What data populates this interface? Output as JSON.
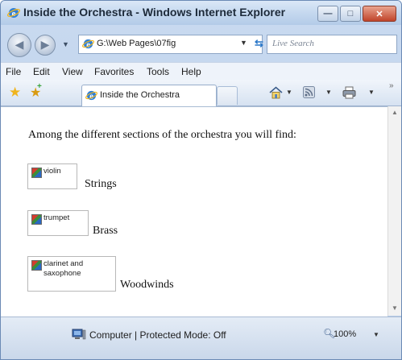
{
  "window": {
    "title": "Inside the Orchestra - Windows Internet Explorer",
    "minimize_glyph": "—",
    "maximize_glyph": "□",
    "close_glyph": "✕"
  },
  "address_bar": {
    "path": "G:\\Web Pages\\07fig",
    "search_placeholder": "Live Search"
  },
  "menu": [
    {
      "label": "File"
    },
    {
      "label": "Edit"
    },
    {
      "label": "View"
    },
    {
      "label": "Favorites"
    },
    {
      "label": "Tools"
    },
    {
      "label": "Help"
    }
  ],
  "tab": {
    "label": "Inside the Orchestra"
  },
  "page": {
    "intro": "Among the different sections of the orchestra you will find:",
    "sections": [
      {
        "alt": "violin",
        "caption": "Strings"
      },
      {
        "alt": "trumpet",
        "caption": "Brass"
      },
      {
        "alt": "clarinet and saxophone",
        "caption": "Woodwinds"
      }
    ]
  },
  "status": {
    "text": "Computer | Protected Mode: Off",
    "zoom": "100%"
  },
  "icons": [
    "ie-logo-icon",
    "back-icon",
    "forward-icon",
    "refresh-icon",
    "stop-icon",
    "favorites-star-icon",
    "add-favorite-icon",
    "home-icon",
    "feeds-icon",
    "print-icon",
    "broken-image-icon",
    "computer-icon",
    "zoom-icon"
  ]
}
